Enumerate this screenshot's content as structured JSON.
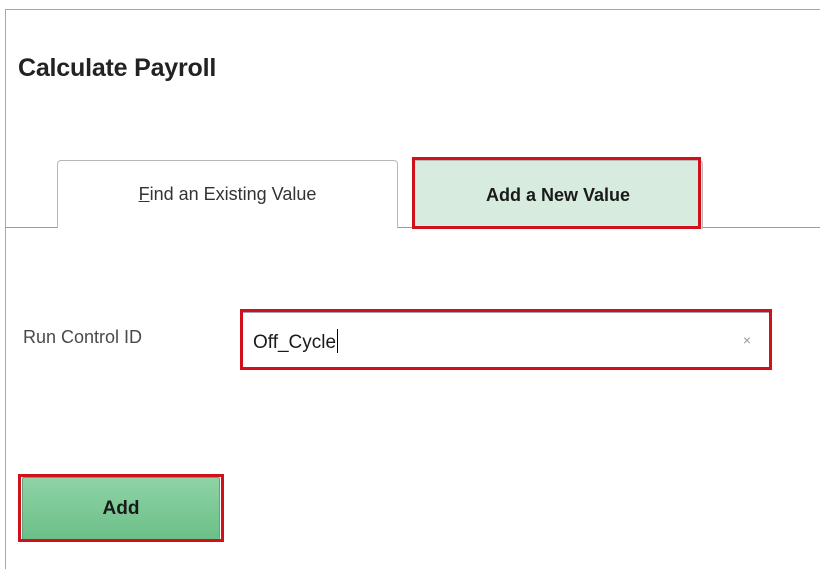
{
  "page": {
    "title": "Calculate Payroll"
  },
  "tabs": [
    {
      "label_underlined": "F",
      "label_rest": "ind an Existing Value",
      "active": false
    },
    {
      "label": "Add a New Value",
      "active": true
    }
  ],
  "form": {
    "run_control_label": "Run Control ID",
    "run_control_value": "Off_Cycle",
    "clear_glyph": "×"
  },
  "actions": {
    "add_label": "Add"
  },
  "colors": {
    "highlight": "#d0101a",
    "active_tab_bg": "#d7ecdf",
    "button_green": "#6cbf88"
  }
}
